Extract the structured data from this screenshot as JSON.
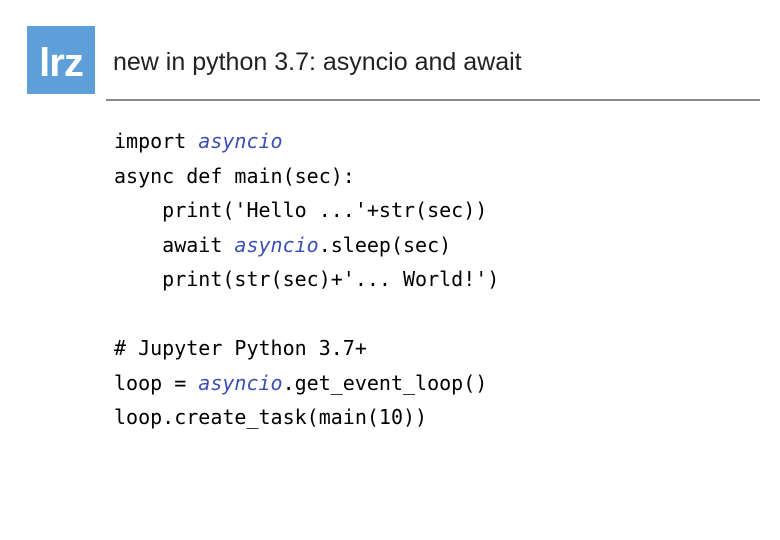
{
  "logo": {
    "text": "lrz"
  },
  "slide": {
    "title": "new in python 3.7: asyncio and await"
  },
  "code": {
    "lines": [
      [
        {
          "t": "import ",
          "c": "kw"
        },
        {
          "t": "asyncio",
          "c": "mod"
        }
      ],
      [
        {
          "t": "async def main(sec):",
          "c": "kw"
        }
      ],
      [
        {
          "t": "    print('Hello ...'+str(sec))",
          "c": "kw"
        }
      ],
      [
        {
          "t": "    await ",
          "c": "kw"
        },
        {
          "t": "asyncio",
          "c": "mod"
        },
        {
          "t": ".sleep(sec)",
          "c": "kw"
        }
      ],
      [
        {
          "t": "    print(str(sec)+'... World!')",
          "c": "kw"
        }
      ],
      [
        {
          "t": "",
          "c": "kw"
        }
      ],
      [
        {
          "t": "# Jupyter Python 3.7+",
          "c": "kw"
        }
      ],
      [
        {
          "t": "loop = ",
          "c": "kw"
        },
        {
          "t": "asyncio",
          "c": "mod"
        },
        {
          "t": ".get_event_loop()",
          "c": "kw"
        }
      ],
      [
        {
          "t": "loop.create_task(main(10))",
          "c": "kw"
        }
      ]
    ]
  }
}
